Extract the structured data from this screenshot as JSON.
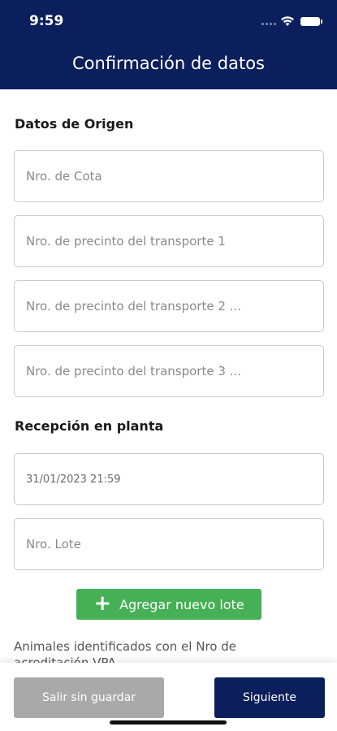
{
  "status_bar": {
    "time": "9:59"
  },
  "header": {
    "title": "Confirmación de datos"
  },
  "origin": {
    "title": "Datos de Origen",
    "cota_placeholder": "Nro. de Cota",
    "seal1_placeholder": "Nro. de precinto del transporte 1",
    "seal2_placeholder": "Nro. de precinto del transporte 2 ...",
    "seal3_placeholder": "Nro. de precinto del transporte 3 ..."
  },
  "reception": {
    "title": "Recepción en planta",
    "datetime_value": "31/01/2023 21:59",
    "lot_placeholder": "Nro. Lote",
    "add_lot_label": "Agregar nuevo lote"
  },
  "animals_text": "Animales identificados con el Nro de acreditación VPA",
  "footer": {
    "exit_label": "Salir sin guardar",
    "next_label": "Siguiente"
  },
  "colors": {
    "primary": "#0a1f5c",
    "accent_green": "#45b055",
    "disabled_gray": "#a9a9a9"
  }
}
